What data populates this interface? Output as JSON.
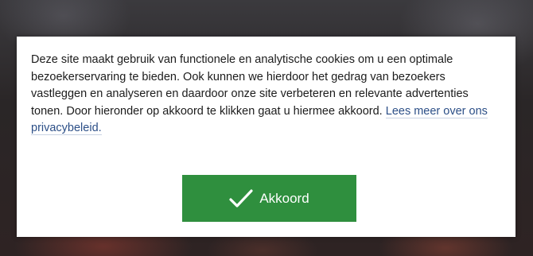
{
  "consent": {
    "message": "Deze site maakt gebruik van functionele en analytische cookies om u een optimale bezoekerservaring te bieden. Ook kunnen we hierdoor het gedrag van bezoekers vastleggen en analyseren en daardoor onze site verbeteren en relevante advertenties tonen. Door hieronder op akkoord te klikken gaat u hiermee akkoord.",
    "privacy_link_label": "Lees meer over ons privacybeleid.",
    "accept_label": "Akkoord",
    "accept_icon": "checkmark-icon",
    "colors": {
      "button_bg": "#2f8f3e",
      "button_text": "#ffffff",
      "link": "#2c4f87",
      "text": "#1c1c1c"
    }
  }
}
